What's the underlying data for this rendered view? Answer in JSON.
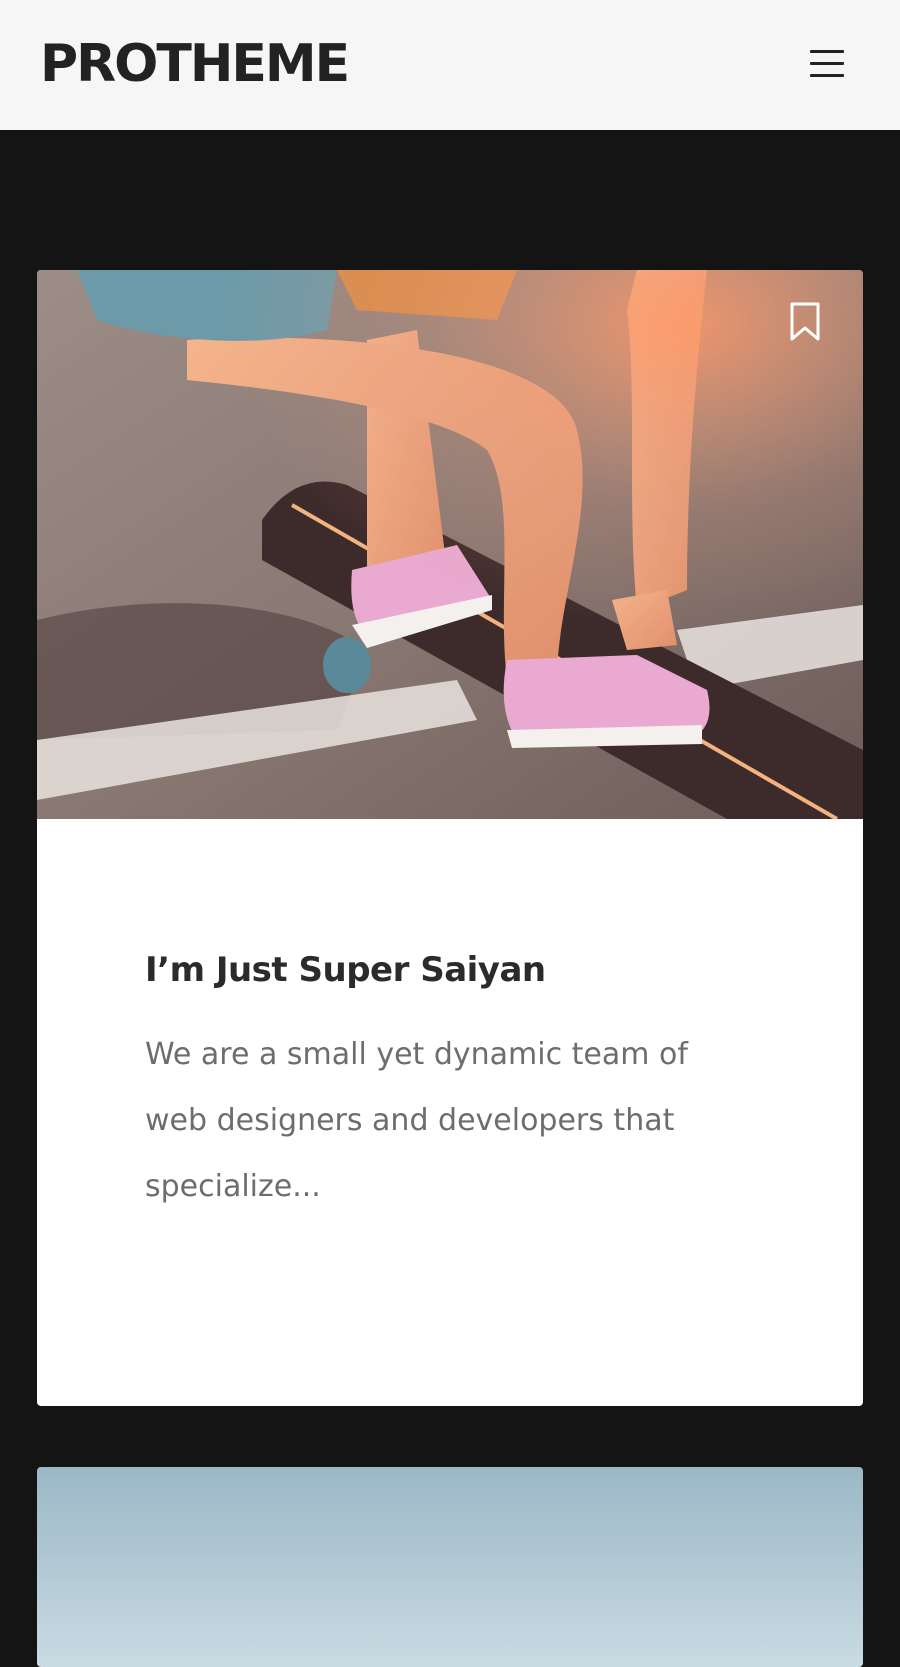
{
  "header": {
    "logo": "PROTHEME",
    "menu_icon": "hamburger-menu-icon"
  },
  "posts": [
    {
      "image_alt": "Girl in pink sneakers on a skateboard",
      "bookmark_icon": "bookmark-icon",
      "title": "I’m Just Super Saiyan",
      "excerpt": "We are a small yet dynamic team of web designers and developers that specialize..."
    }
  ],
  "colors": {
    "page_background": "#141414",
    "header_background": "#f6f6f6",
    "card_background": "#ffffff",
    "title_color": "#2b2b2b",
    "excerpt_color": "#6d6d6d"
  }
}
